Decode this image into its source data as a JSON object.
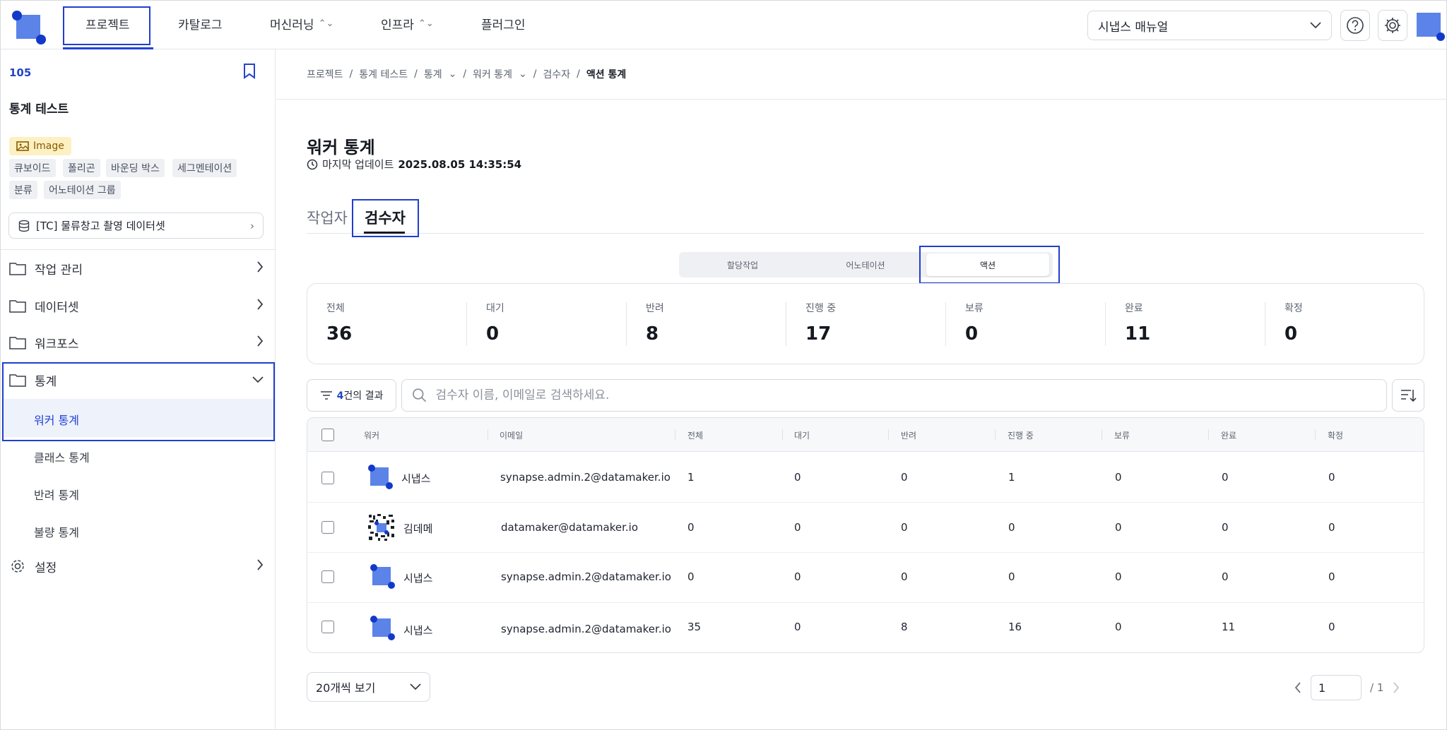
{
  "topnav": {
    "items": [
      {
        "label": "프로젝트",
        "dropdown": false
      },
      {
        "label": "카탈로그",
        "dropdown": false
      },
      {
        "label": "머신러닝",
        "dropdown": true
      },
      {
        "label": "인프라",
        "dropdown": true
      },
      {
        "label": "플러그인",
        "dropdown": false
      }
    ],
    "active_index": 0,
    "manual_select": "시냅스 매뉴얼",
    "help_icon": "help-circle-icon",
    "settings_icon": "gear-icon"
  },
  "sidebar": {
    "project_id": "105",
    "project_name": "통계 테스트",
    "data_type": "Image",
    "annotation_tags": [
      "큐보이드",
      "폴리곤",
      "바운딩 박스",
      "세그멘테이션",
      "분류",
      "어노테이션 그룹"
    ],
    "dataset": "[TC] 물류창고 촬영 데이터셋",
    "menus": [
      {
        "label": "작업 관리",
        "icon": "folder-icon"
      },
      {
        "label": "데이터셋",
        "icon": "folder-icon"
      },
      {
        "label": "워크포스",
        "icon": "folder-icon"
      },
      {
        "label": "통계",
        "icon": "folder-icon"
      },
      {
        "label": "설정",
        "icon": "gear-icon"
      }
    ],
    "stats_submenu": [
      "워커 통계",
      "클래스 통계",
      "반려 통계",
      "불량 통계"
    ],
    "active_submenu": "워커 통계"
  },
  "breadcrumb": [
    {
      "label": "프로젝트",
      "dropdown": false
    },
    {
      "label": "통계 테스트",
      "dropdown": false
    },
    {
      "label": "통계",
      "dropdown": true
    },
    {
      "label": "워커 통계",
      "dropdown": true
    },
    {
      "label": "검수자",
      "dropdown": false
    },
    {
      "label": "액션 통계",
      "dropdown": false
    }
  ],
  "page": {
    "title": "워커 통계",
    "updated_label": "마지막 업데이트",
    "updated_value": "2025.08.05 14:35:54"
  },
  "tabs": [
    "작업자",
    "검수자"
  ],
  "active_tab": "검수자",
  "segments": [
    "할당작업",
    "어노테이션",
    "액션"
  ],
  "active_segment": "액션",
  "stats": [
    {
      "label": "전체",
      "value": "36"
    },
    {
      "label": "대기",
      "value": "0"
    },
    {
      "label": "반려",
      "value": "8"
    },
    {
      "label": "진행 중",
      "value": "17"
    },
    {
      "label": "보류",
      "value": "0"
    },
    {
      "label": "완료",
      "value": "11"
    },
    {
      "label": "확정",
      "value": "0"
    }
  ],
  "filter": {
    "count": "4",
    "suffix": "건의 결과"
  },
  "search": {
    "placeholder": "검수자 이름, 이메일로 검색하세요."
  },
  "table": {
    "columns": [
      "워커",
      "이메일",
      "전체",
      "대기",
      "반려",
      "진행 중",
      "보류",
      "완료",
      "확정"
    ],
    "rows": [
      {
        "name": "시냅스",
        "avatar": "logo",
        "email": "synapse.admin.2@datamaker.io",
        "total": "1",
        "waiting": "0",
        "rejected": "0",
        "in_progress": "1",
        "hold": "0",
        "done": "0",
        "confirmed": "0"
      },
      {
        "name": "김데메",
        "avatar": "qr",
        "email": "datamaker@datamaker.io",
        "total": "0",
        "waiting": "0",
        "rejected": "0",
        "in_progress": "0",
        "hold": "0",
        "done": "0",
        "confirmed": "0"
      },
      {
        "name": "시냅스",
        "avatar": "logo",
        "email": "synapse.admin.2@datamaker.io",
        "total": "0",
        "waiting": "0",
        "rejected": "0",
        "in_progress": "0",
        "hold": "0",
        "done": "0",
        "confirmed": "0"
      },
      {
        "name": "시냅스",
        "avatar": "logo",
        "email": "synapse.admin.2@datamaker.io",
        "total": "35",
        "waiting": "0",
        "rejected": "8",
        "in_progress": "16",
        "hold": "0",
        "done": "11",
        "confirmed": "0"
      }
    ]
  },
  "pagination": {
    "page_size": "20개씩 보기",
    "current_page": "1",
    "total_pages": "/ 1"
  },
  "colors": {
    "accent": "#2243d6",
    "highlight_border": "#1f3fcf",
    "brand": "#5b83e8"
  }
}
